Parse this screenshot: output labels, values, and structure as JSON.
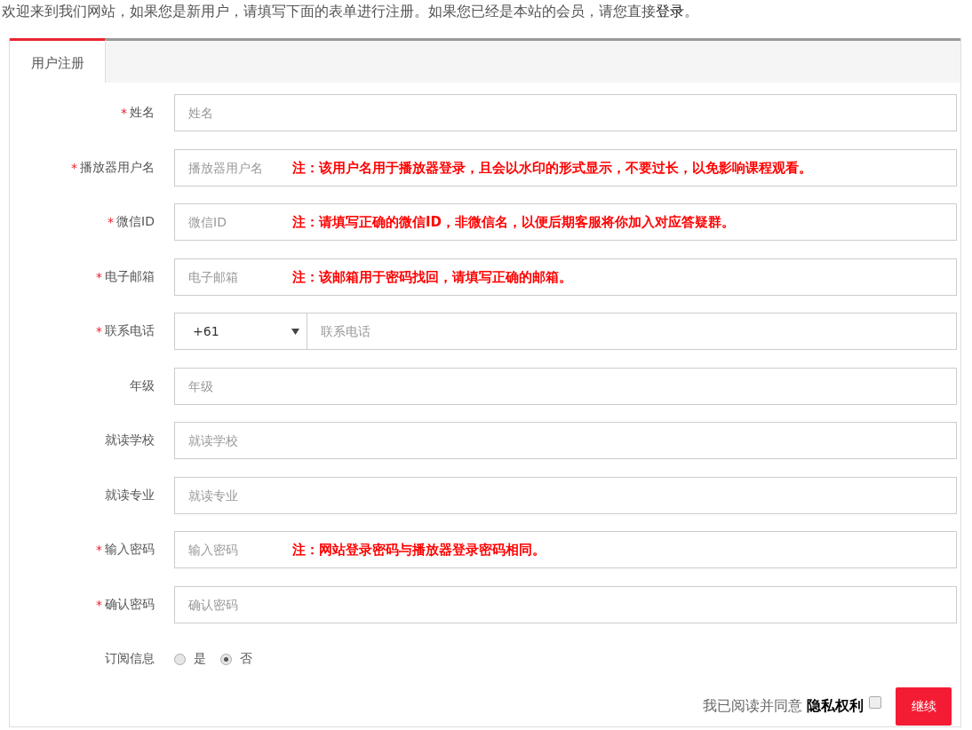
{
  "intro": {
    "text": "欢迎来到我们网站，如果您是新用户，请填写下面的表单进行注册。如果您已经是本站的会员，请您直接",
    "link": "登录",
    "end": "。"
  },
  "tabs": [
    {
      "label": "用户注册",
      "selected": true
    }
  ],
  "fields": [
    {
      "kind": "text",
      "label": "姓名",
      "marker": "*",
      "placeholder": "姓名"
    },
    {
      "kind": "text",
      "label": "播放器用户名",
      "marker": "*",
      "placeholder": "播放器用户名",
      "note": "注：该用户名用于播放器登录，且会以水印的形式显示，不要过长，以免影响课程观看。"
    },
    {
      "kind": "text",
      "label": "微信ID",
      "marker": "*",
      "placeholder": "微信ID",
      "note": "注：请填写正确的微信ID，非微信名，以便后期客服将你加入对应答疑群。"
    },
    {
      "kind": "text",
      "label": "电子邮箱",
      "marker": "*",
      "placeholder": "电子邮箱",
      "note": "注：该邮箱用于密码找回，请填写正确的邮箱。"
    },
    {
      "kind": "phone",
      "label": "联系电话",
      "marker": "*",
      "code": "+61",
      "placeholder": "联系电话"
    },
    {
      "kind": "text",
      "label": "年级",
      "placeholder": "年级"
    },
    {
      "kind": "text",
      "label": "就读学校",
      "placeholder": "就读学校"
    },
    {
      "kind": "text",
      "label": "就读专业",
      "placeholder": "就读专业"
    },
    {
      "kind": "text",
      "label": "输入密码",
      "marker": "*",
      "placeholder": "输入密码",
      "note": "注：网站登录密码与播放器登录密码相同。"
    },
    {
      "kind": "text",
      "label": "确认密码",
      "marker": "*",
      "placeholder": "确认密码"
    },
    {
      "kind": "radio",
      "label": "订阅信息",
      "options": [
        {
          "label": "是",
          "selected": false
        },
        {
          "label": "否",
          "selected": true
        }
      ]
    }
  ],
  "agreement": {
    "text": "我已阅读并同意 **隐私权利**",
    "checked": false
  },
  "submit": "继续"
}
